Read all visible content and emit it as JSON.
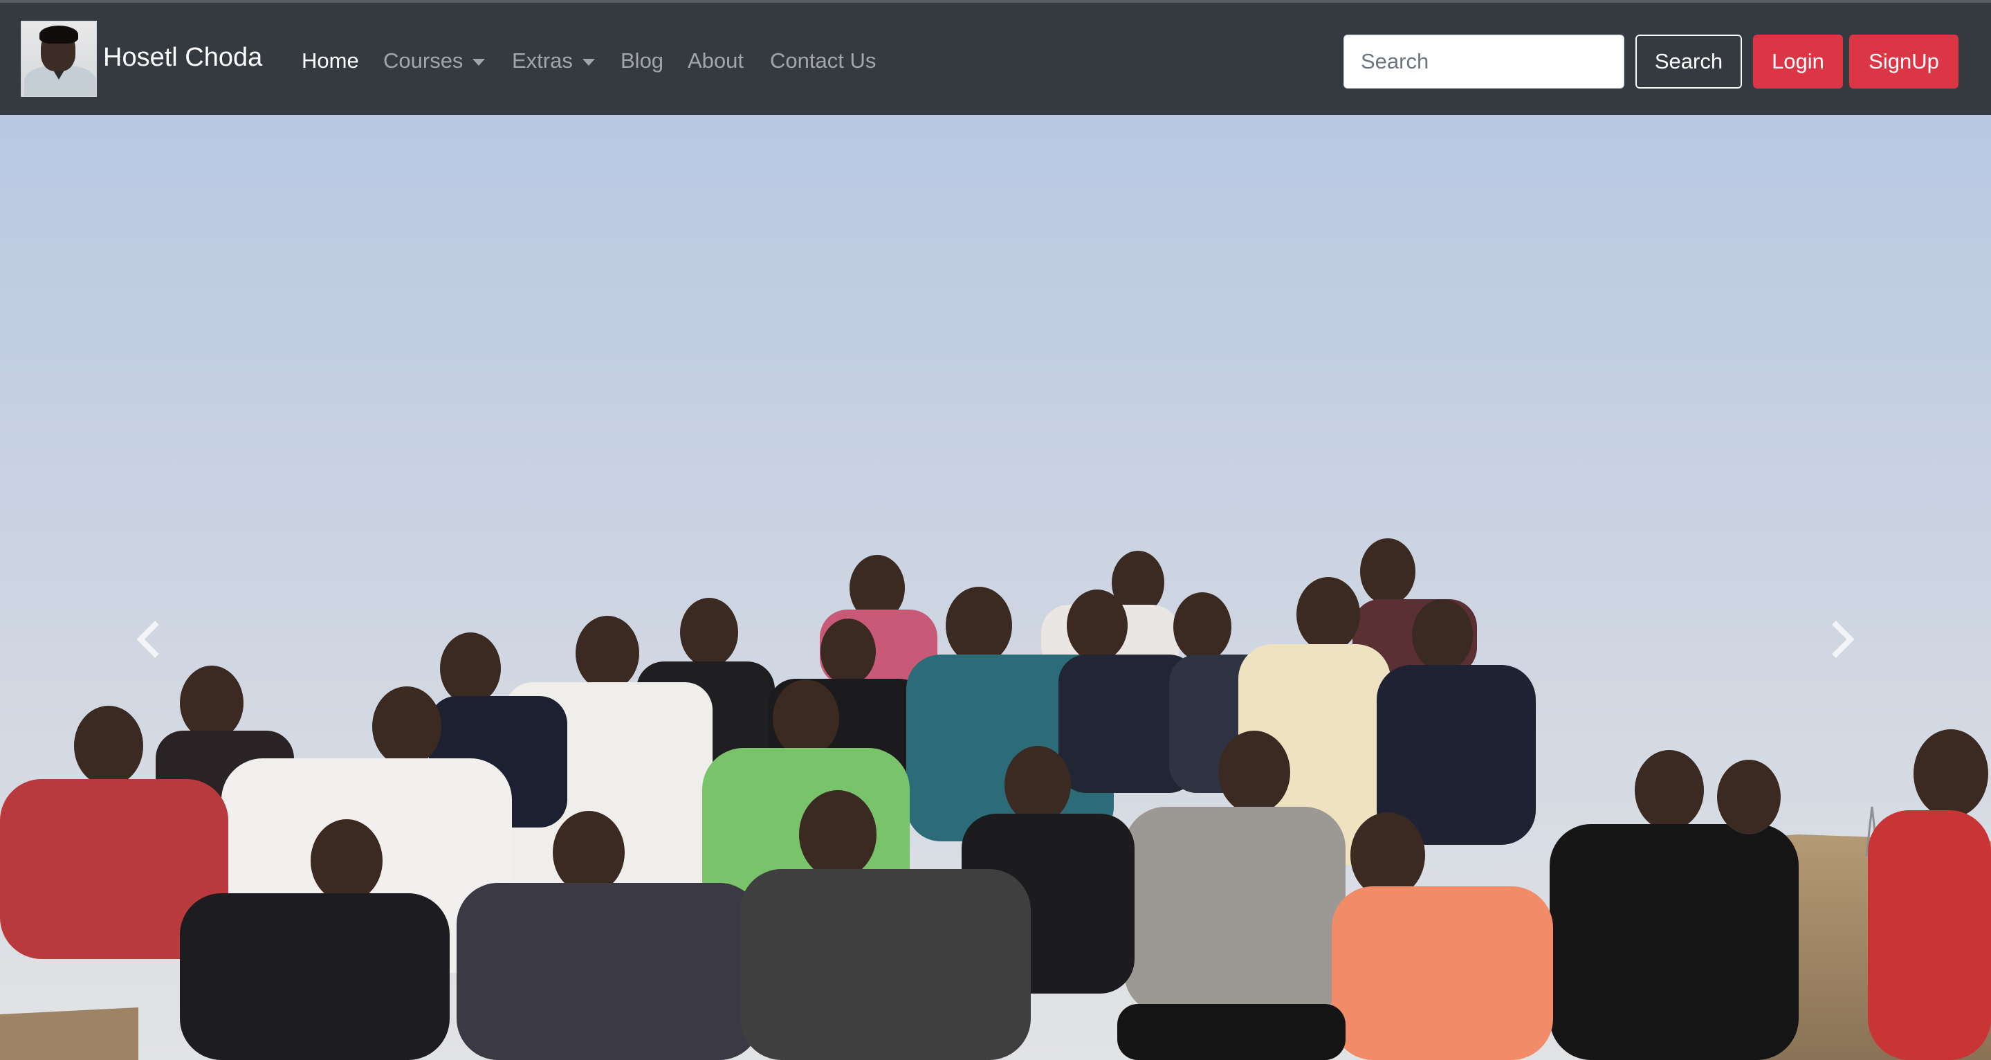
{
  "navbar": {
    "brand": {
      "name": "Hosetl Choda",
      "logo_icon": "profile-photo"
    },
    "links": [
      {
        "label": "Home",
        "active": true,
        "dropdown": false
      },
      {
        "label": "Courses",
        "active": false,
        "dropdown": true
      },
      {
        "label": "Extras",
        "active": false,
        "dropdown": true
      },
      {
        "label": "Blog",
        "active": false,
        "dropdown": false
      },
      {
        "label": "About",
        "active": false,
        "dropdown": false
      },
      {
        "label": "Contact Us",
        "active": false,
        "dropdown": false
      }
    ],
    "search": {
      "placeholder": "Search",
      "value": "",
      "button_label": "Search"
    },
    "login_label": "Login",
    "signup_label": "SignUp"
  },
  "carousel": {
    "image_alt": "group-photo",
    "prev_icon": "chevron-left-icon",
    "next_icon": "chevron-right-icon"
  },
  "colors": {
    "navbar_bg": "#343a40",
    "danger": "#dc3545",
    "sky_top": "#b9c9e3",
    "sky_bottom": "#dfe2e6"
  }
}
